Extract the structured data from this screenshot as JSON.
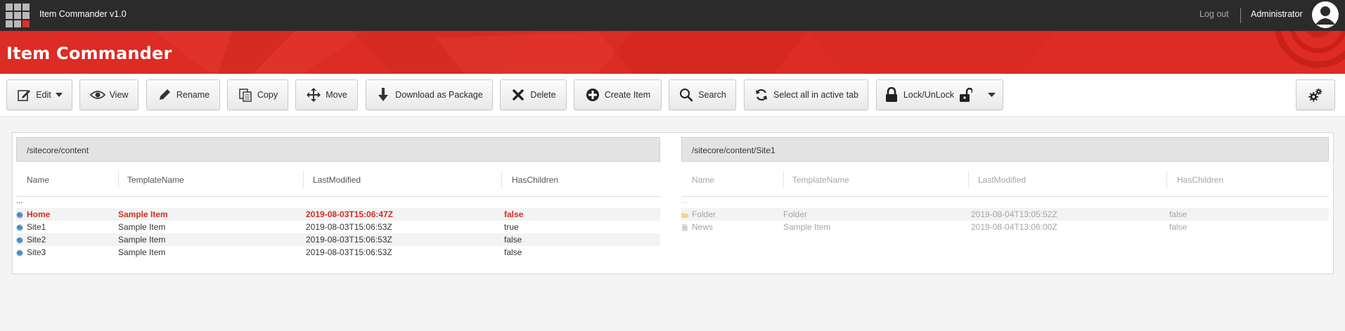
{
  "topbar": {
    "app_title": "Item Commander v1.0",
    "logout": "Log out",
    "username": "Administrator"
  },
  "header": {
    "title": "Item Commander",
    "accent_color": "#dc2c23"
  },
  "toolbar": {
    "edit": "Edit",
    "view": "View",
    "rename": "Rename",
    "copy": "Copy",
    "move": "Move",
    "download": "Download as Package",
    "delete": "Delete",
    "create": "Create Item",
    "search": "Search",
    "select_all": "Select all in active tab",
    "lock": "Lock/UnLock"
  },
  "left_pane": {
    "path": "/sitecore/content",
    "columns": [
      "Name",
      "TemplateName",
      "LastModified",
      "HasChildren"
    ],
    "up": "...",
    "rows": [
      {
        "icon": "globe-icon",
        "name": "Home",
        "template": "Sample Item",
        "modified": "2019-08-03T15:06:47Z",
        "children": "false",
        "selected": true
      },
      {
        "icon": "globe-icon",
        "name": "Site1",
        "template": "Sample Item",
        "modified": "2019-08-03T15:06:53Z",
        "children": "true",
        "selected": false
      },
      {
        "icon": "globe-icon",
        "name": "Site2",
        "template": "Sample Item",
        "modified": "2019-08-03T15:06:53Z",
        "children": "false",
        "selected": false
      },
      {
        "icon": "globe-icon",
        "name": "Site3",
        "template": "Sample Item",
        "modified": "2019-08-03T15:06:53Z",
        "children": "false",
        "selected": false
      }
    ]
  },
  "right_pane": {
    "path": "/sitecore/content/Site1",
    "columns": [
      "Name",
      "TemplateName",
      "LastModified",
      "HasChildren"
    ],
    "up": "...",
    "rows": [
      {
        "icon": "folder-icon",
        "name": "Folder",
        "template": "Folder",
        "modified": "2019-08-04T13:05:52Z",
        "children": "false"
      },
      {
        "icon": "document-icon",
        "name": "News",
        "template": "Sample Item",
        "modified": "2019-08-04T13:06:00Z",
        "children": "false"
      }
    ]
  }
}
